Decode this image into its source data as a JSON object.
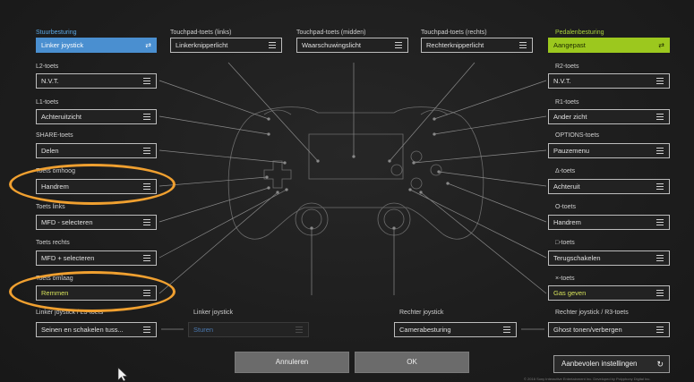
{
  "left": {
    "steer_label": "Stuurbesturing",
    "steer_value": "Linker joystick",
    "l2_label": "L2-toets",
    "l2_value": "N.V.T.",
    "l1_label": "L1-toets",
    "l1_value": "Achteruitzicht",
    "share_label": "SHARE-toets",
    "share_value": "Delen",
    "up_label": "Toets omhoog",
    "up_value": "Handrem",
    "leftkey_label": "Toets links",
    "leftkey_value": "MFD - selecteren",
    "rightkey_label": "Toets rechts",
    "rightkey_value": "MFD + selecteren",
    "down_label": "Toets omlaag",
    "down_value": "Remmen",
    "l3_label": "Linker joystick / L3-toets",
    "l3_value": "Seinen en schakelen tuss..."
  },
  "top": {
    "tp_left_label": "Touchpad-toets (links)",
    "tp_left_value": "Linkerknipperlicht",
    "tp_mid_label": "Touchpad-toets (midden)",
    "tp_mid_value": "Waarschuwingslicht",
    "tp_right_label": "Touchpad-toets (rechts)",
    "tp_right_value": "Rechterknipperlicht"
  },
  "right": {
    "pedal_label": "Pedalenbesturing",
    "pedal_value": "Aangepast",
    "r2_label": "R2-toets",
    "r2_value": "N.V.T.",
    "r1_label": "R1-toets",
    "r1_value": "Ander zicht",
    "options_label": "OPTIONS-toets",
    "options_value": "Pauzemenu",
    "triangle_label": "Δ-toets",
    "triangle_value": "Achteruit",
    "circle_label": "O-toets",
    "circle_value": "Handrem",
    "square_label": "□-toets",
    "square_value": "Terugschakelen",
    "cross_label": "×-toets",
    "cross_value": "Gas geven",
    "r3_label": "Rechter joystick / R3-toets",
    "r3_value": "Ghost tonen/verbergen"
  },
  "bottom": {
    "ljoy_label": "Linker joystick",
    "ljoy_value": "Sturen",
    "rjoy_label": "Rechter joystick",
    "rjoy_value": "Camerabesturing"
  },
  "actions": {
    "cancel": "Annuleren",
    "ok": "OK",
    "recommended": "Aanbevolen instellingen"
  },
  "footer": "© 2016 Sony Interactive Entertainment Inc.   Developed by Polyphony Digital Inc.",
  "colors": {
    "accent_blue": "#4a8fd0",
    "accent_lime": "#9cc81e",
    "highlight_ring": "#f0a030"
  },
  "icons": {
    "sync": "sync-arrows-icon",
    "menu": "hamburger-menu-icon",
    "cursor": "mouse-pointer-icon"
  }
}
